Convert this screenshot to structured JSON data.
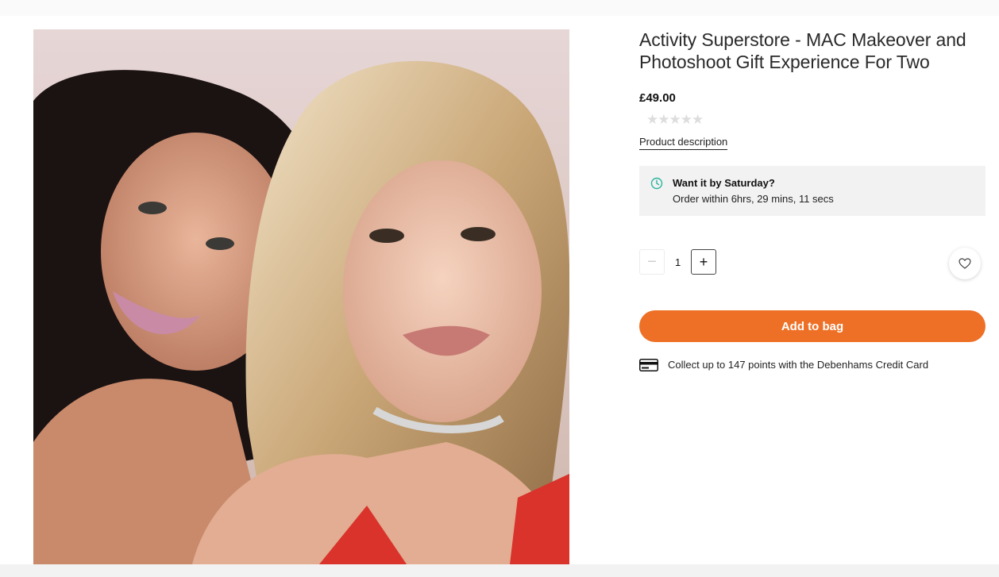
{
  "product": {
    "title": "Activity Superstore - MAC Makeover and Photoshoot Gift Experience For Two",
    "price": "£49.00",
    "rating_stars": "★★★★★",
    "description_link": "Product description"
  },
  "delivery": {
    "heading": "Want it by Saturday?",
    "countdown": "Order within 6hrs, 29 mins, 11 secs",
    "icon": "clock-icon"
  },
  "quantity": {
    "minus_label": "−",
    "value": "1",
    "plus_label": "+"
  },
  "wishlist": {
    "icon": "heart-icon"
  },
  "add_to_bag": {
    "label": "Add to bag",
    "color": "#ee7026"
  },
  "credit": {
    "text": "Collect up to 147 points with the Debenhams Credit Card",
    "icon": "credit-card-icon"
  },
  "image": {
    "alt": "Two women posing for photoshoot"
  }
}
